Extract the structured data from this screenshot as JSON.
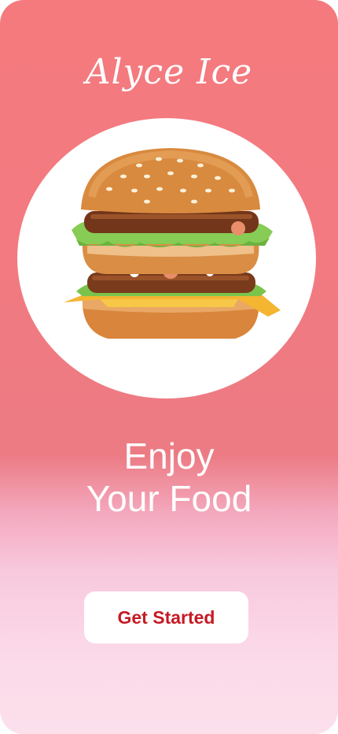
{
  "brand": {
    "title": "Alyce Ice"
  },
  "hero": {
    "image_icon": "burger-image"
  },
  "headline": {
    "line1": "Enjoy",
    "line2": "Your Food"
  },
  "cta": {
    "label": "Get Started"
  },
  "colors": {
    "gradient_top": "#f47a7e",
    "gradient_bottom": "#fce0ec",
    "cta_text": "#c61a24",
    "text_light": "#ffffff"
  }
}
